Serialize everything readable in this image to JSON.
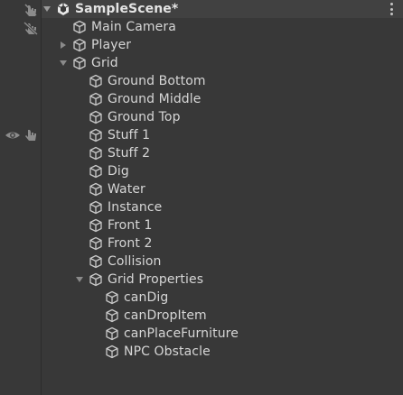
{
  "hierarchy": {
    "scene": {
      "label": "SampleScene*"
    },
    "items": [
      {
        "label": "Main Camera",
        "depth": 0,
        "expander": "none"
      },
      {
        "label": "Player",
        "depth": 0,
        "expander": "collapsed"
      },
      {
        "label": "Grid",
        "depth": 0,
        "expander": "expanded"
      },
      {
        "label": "Ground Bottom",
        "depth": 1,
        "expander": "none"
      },
      {
        "label": "Ground Middle",
        "depth": 1,
        "expander": "none"
      },
      {
        "label": "Ground Top",
        "depth": 1,
        "expander": "none"
      },
      {
        "label": "Stuff 1",
        "depth": 1,
        "expander": "none"
      },
      {
        "label": "Stuff 2",
        "depth": 1,
        "expander": "none"
      },
      {
        "label": "Dig",
        "depth": 1,
        "expander": "none"
      },
      {
        "label": "Water",
        "depth": 1,
        "expander": "none"
      },
      {
        "label": "Instance",
        "depth": 1,
        "expander": "none"
      },
      {
        "label": "Front 1",
        "depth": 1,
        "expander": "none"
      },
      {
        "label": "Front 2",
        "depth": 1,
        "expander": "none"
      },
      {
        "label": "Collision",
        "depth": 1,
        "expander": "none"
      },
      {
        "label": "Grid Properties",
        "depth": 1,
        "expander": "expanded"
      },
      {
        "label": "canDig",
        "depth": 2,
        "expander": "none"
      },
      {
        "label": "canDropItem",
        "depth": 2,
        "expander": "none"
      },
      {
        "label": "canPlaceFurniture",
        "depth": 2,
        "expander": "none"
      },
      {
        "label": "NPC Obstacle",
        "depth": 2,
        "expander": "none"
      }
    ]
  },
  "icons": {
    "scene": "unity-scene-icon",
    "gameobject": "gameobject-cube-icon",
    "pickable": "hand-pointer-icon",
    "not_pickable": "hand-pointer-crossed-icon",
    "visible": "eye-icon",
    "menu": "kebab-menu-icon"
  },
  "colors": {
    "background": "#383838",
    "scene_row": "#414141",
    "hover_row": "#454545",
    "text": "#d6d6d6",
    "icon": "#c8c8c8"
  }
}
